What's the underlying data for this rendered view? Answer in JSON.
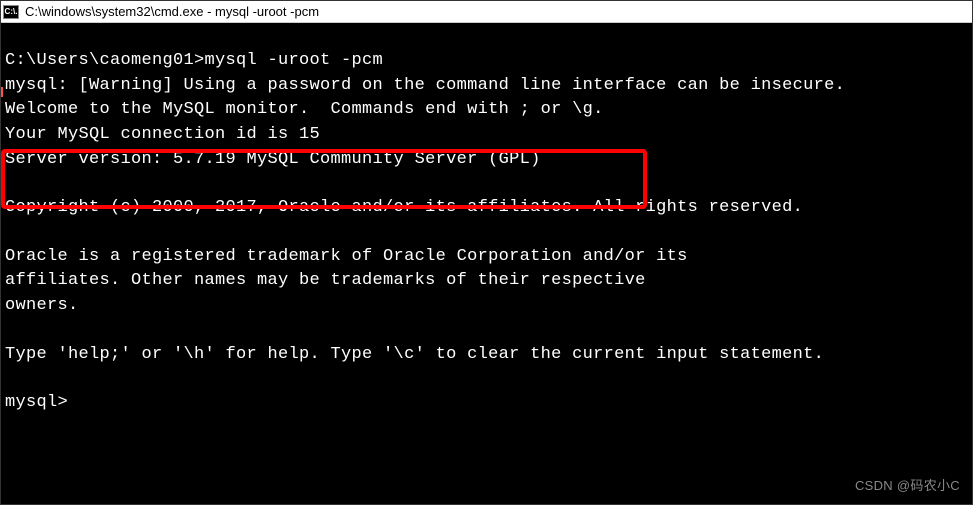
{
  "titlebar": {
    "icon_label": "C:\\.",
    "title": "C:\\windows\\system32\\cmd.exe - mysql  -uroot -pcm"
  },
  "terminal": {
    "prompt_line": "C:\\Users\\caomeng01>mysql -uroot -pcm",
    "warning_line": "mysql: [Warning] Using a password on the command line interface can be insecure.",
    "welcome_line": "Welcome to the MySQL monitor.  Commands end with ; or \\g.",
    "connection_line": "Your MySQL connection id is 15",
    "server_version_line": "Server version: 5.7.19 MySQL Community Server (GPL)",
    "copyright_line": "Copyright (c) 2000, 2017, Oracle and/or its affiliates. All rights reserved.",
    "trademark_line1": "Oracle is a registered trademark of Oracle Corporation and/or its",
    "trademark_line2": "affiliates. Other names may be trademarks of their respective",
    "trademark_line3": "owners.",
    "help_line": "Type 'help;' or '\\h' for help. Type '\\c' to clear the current input statement.",
    "mysql_prompt": "mysql>"
  },
  "watermark": "CSDN @码农小C"
}
